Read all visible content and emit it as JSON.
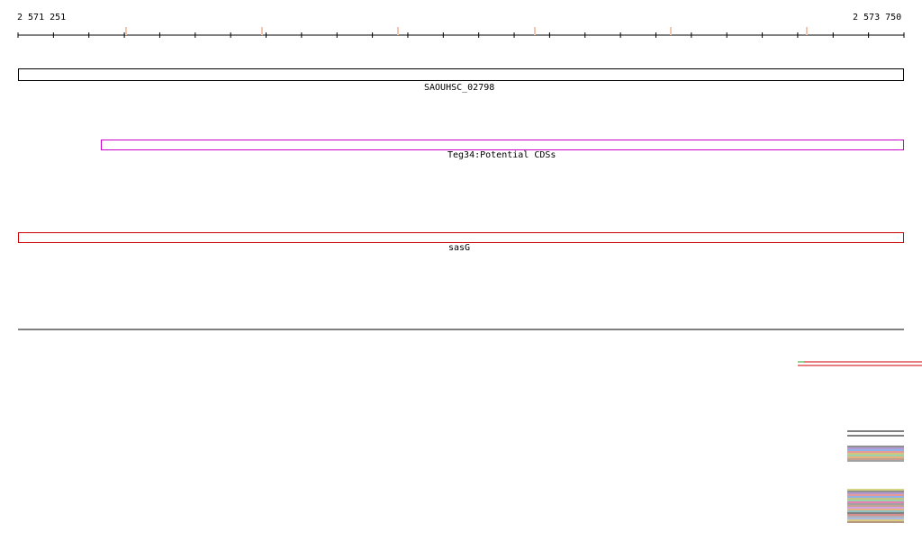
{
  "ruler": {
    "start_label": "2 571 251",
    "end_label": "2 573 750"
  },
  "features": [
    {
      "label": "SAOUHSC_02798",
      "color": "#000000"
    },
    {
      "label": "Teg34:Potential CDSs",
      "color": "#cc00cc"
    },
    {
      "label": "sasG",
      "color": "#cc0000"
    }
  ],
  "colors": {
    "axis": "#000000",
    "tick_accent": "#f3c6b0",
    "track_line": "#000000",
    "alignment_red": "#cc0000",
    "alignment_green": "#2aa02a"
  }
}
